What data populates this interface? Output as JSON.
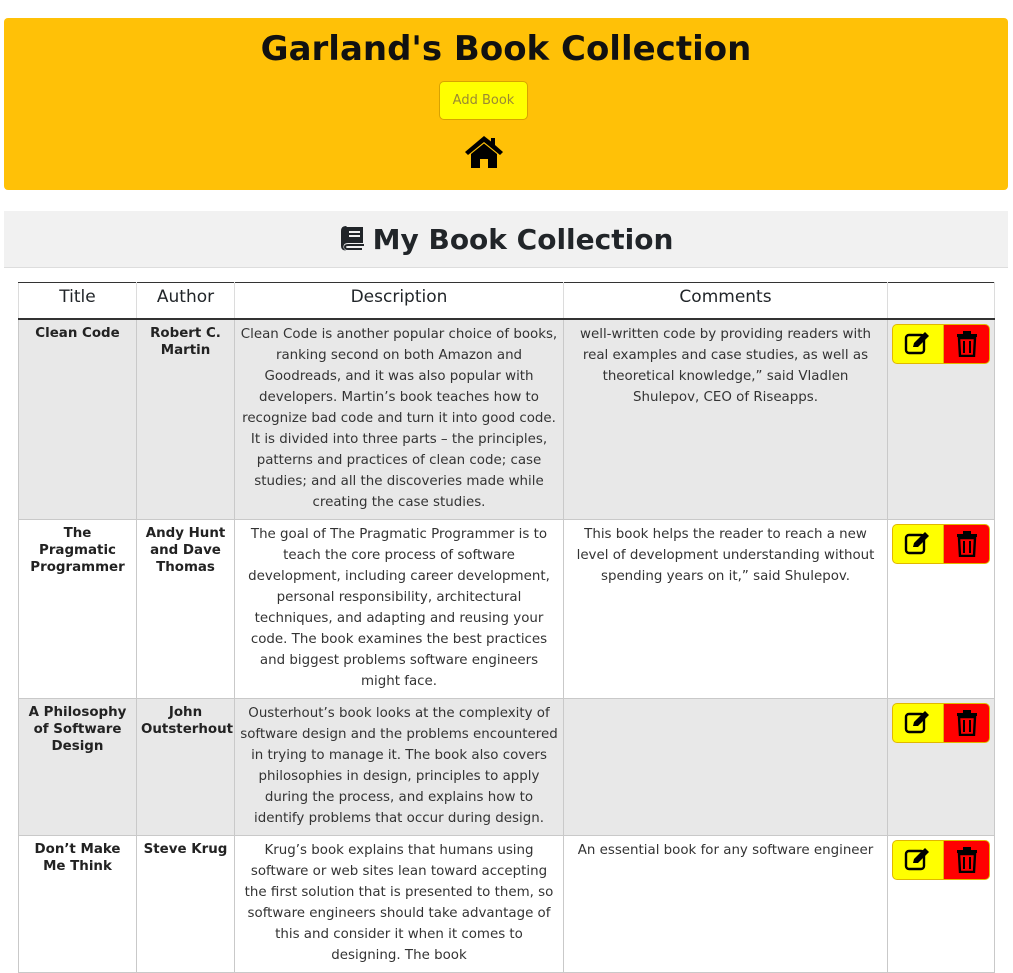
{
  "header": {
    "title": "Garland's Book Collection",
    "add_button": "Add Book",
    "home_icon": "home-icon",
    "background": "#ffc107"
  },
  "section": {
    "title": "My Book Collection",
    "icon": "book-icon"
  },
  "table": {
    "columns": [
      "Title",
      "Author",
      "Description",
      "Comments",
      ""
    ],
    "rows": [
      {
        "title": "Clean Code",
        "author": "Robert C. Martin",
        "description": "Clean Code is another popular choice of books, ranking second on both Amazon and Goodreads, and it was also popular with developers. Martin’s book teaches how to recognize bad code and turn it into good code. It is divided into three parts – the principles, patterns and practices of clean code; case studies; and all the discoveries made while creating the case studies.",
        "comments": "well-written code by providing readers with real examples and case studies, as well as theoretical knowledge,” said Vladlen Shulepov, CEO of Riseapps."
      },
      {
        "title": "The Pragmatic Programmer",
        "author": "Andy Hunt and Dave Thomas",
        "description": "The goal of The Pragmatic Programmer is to teach the core process of software development, including career development, personal responsibility, architectural techniques, and adapting and reusing your code. The book examines the best practices and biggest problems software engineers might face.",
        "comments": "This book helps the reader to reach a new level of development understanding without spending years on it,” said Shulepov."
      },
      {
        "title": "A Philosophy of Software Design",
        "author": "John Outsterhout",
        "description": "Ousterhout’s book looks at the complexity of software design and the problems encountered in trying to manage it. The book also covers philosophies in design, principles to apply during the process, and explains how to identify problems that occur during design.",
        "comments": ""
      },
      {
        "title": "Don’t Make Me Think",
        "author": "Steve Krug",
        "description": "Krug’s book explains that humans using software or web sites lean toward accepting the first solution that is presented to them, so software engineers should take advantage of this and consider it when it comes to designing. The book",
        "comments": "An essential book for any software engineer"
      }
    ],
    "edit_icon": "edit-icon",
    "delete_icon": "trash-icon"
  }
}
